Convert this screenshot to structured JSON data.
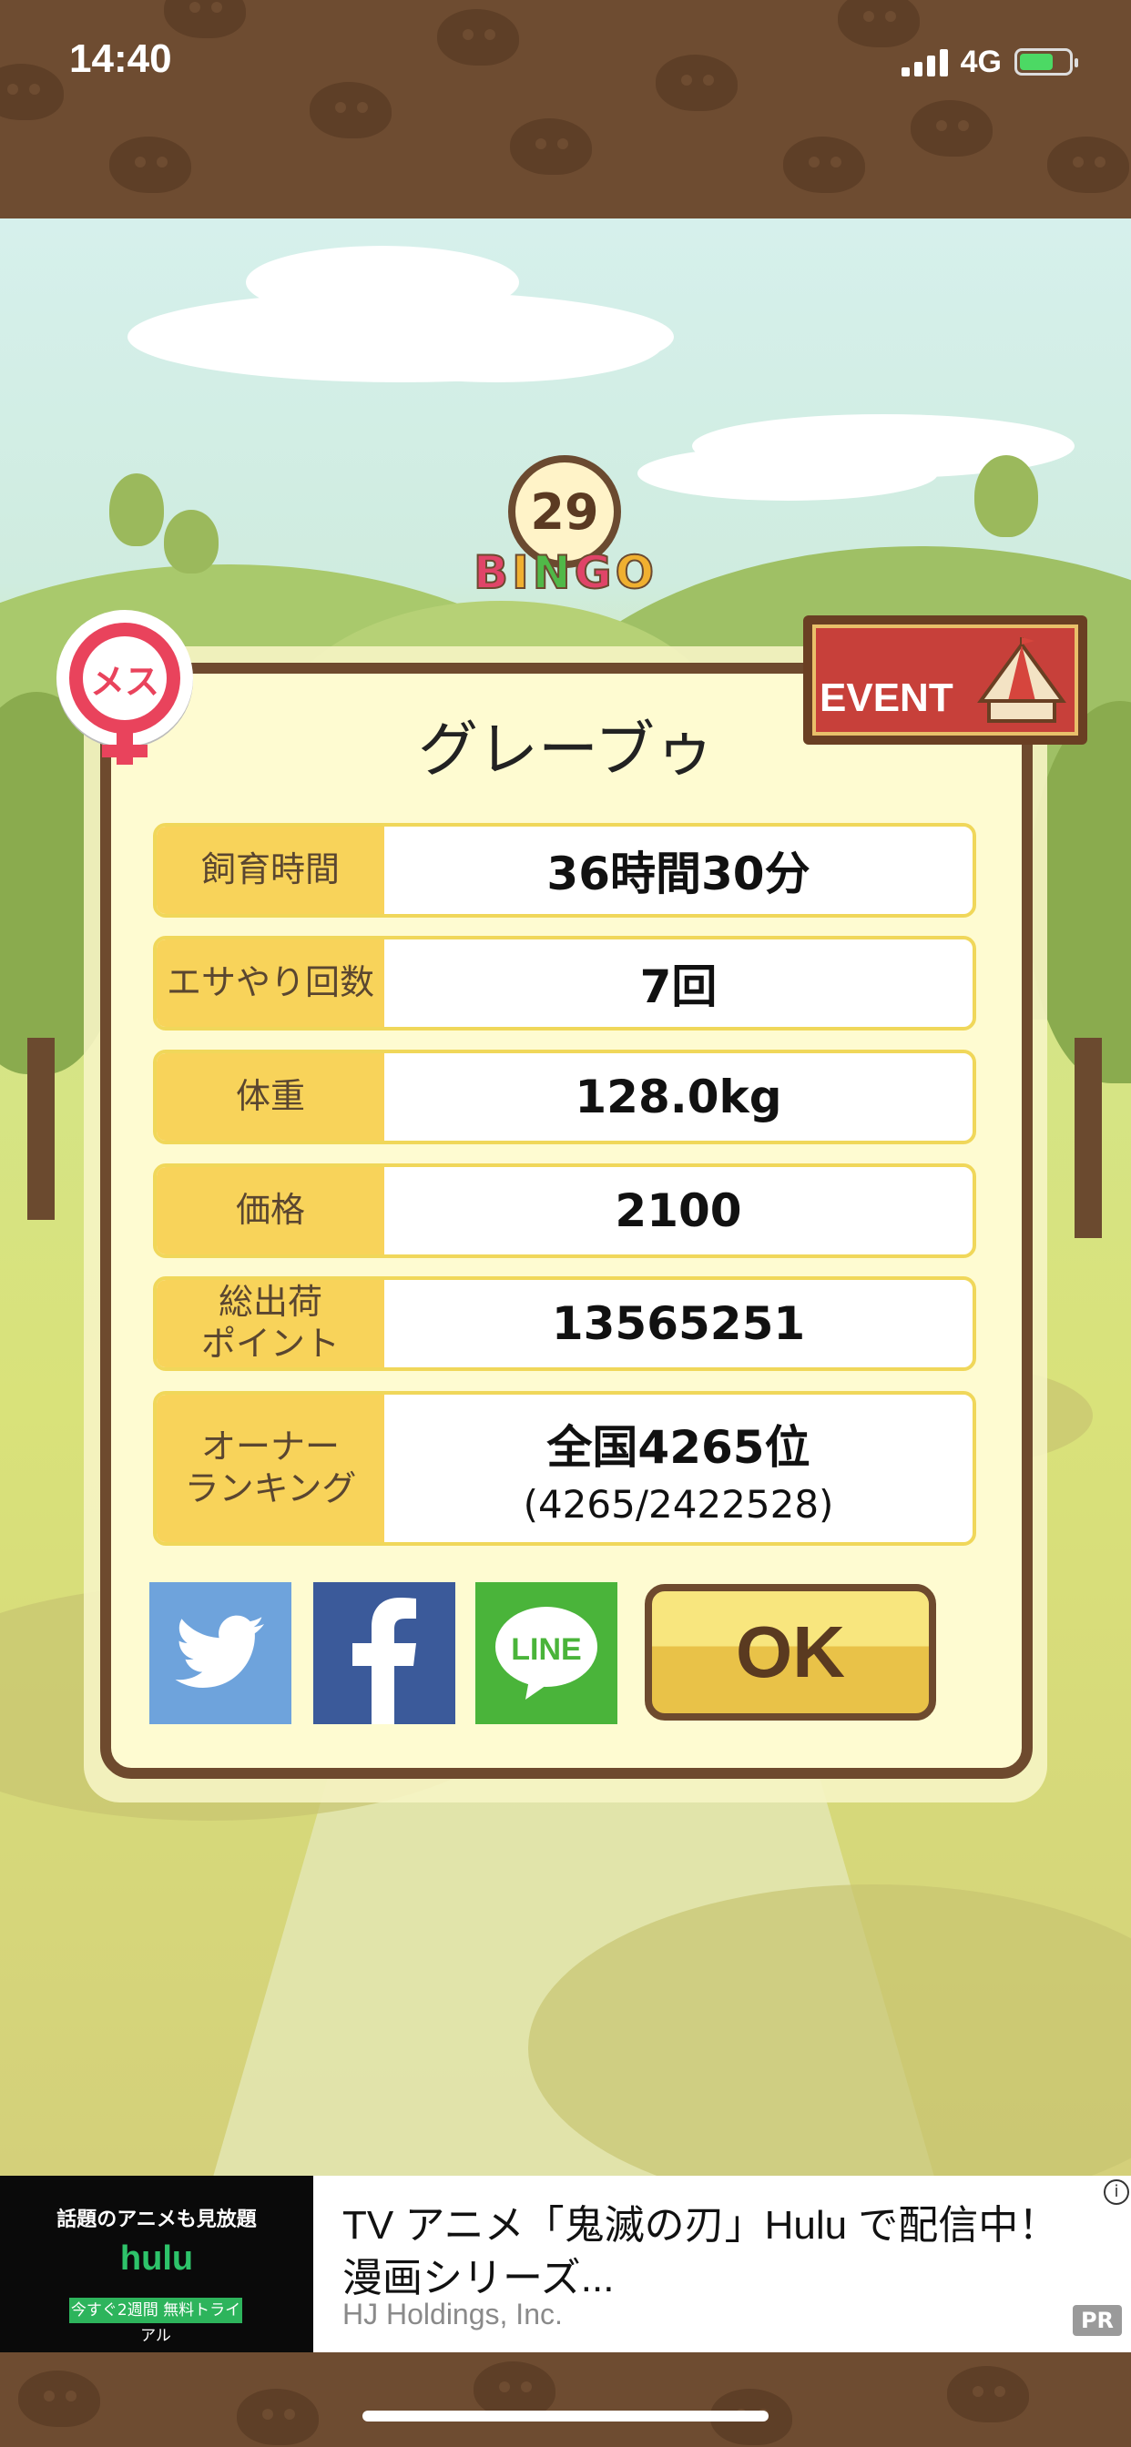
{
  "status_bar": {
    "time": "14:40",
    "network": "4G"
  },
  "bingo": {
    "number": "29",
    "word": "BINGO"
  },
  "badges": {
    "gender": "メス",
    "event": "EVENT"
  },
  "dialog": {
    "title": "グレーブゥ",
    "rows": [
      {
        "label": "飼育時間",
        "value": "36時間30分"
      },
      {
        "label": "エサやり回数",
        "value": "7回"
      },
      {
        "label": "体重",
        "value": "128.0kg"
      },
      {
        "label": "価格",
        "value": "2100"
      },
      {
        "label": "総出荷\nポイント",
        "value": "13565251"
      },
      {
        "label": "オーナー\nランキング",
        "value": "全国4265位",
        "sub": "(4265/2422528)"
      }
    ],
    "share_buttons": [
      {
        "name": "twitter",
        "icon": "twitter-bird-icon",
        "color": "#6ea3dc"
      },
      {
        "name": "facebook",
        "icon": "facebook-f-icon",
        "color": "#3b5a9a"
      },
      {
        "name": "line",
        "icon": "line-logo-icon",
        "color": "#4ab43a",
        "text": "LINE"
      }
    ],
    "ok_label": "OK"
  },
  "ad": {
    "image_tagline": "話題のアニメも見放題",
    "image_logo": "hulu",
    "image_trial": "今すぐ2週間 無料トライアル",
    "title": "TV アニメ「鬼滅の刃」Hulu で配信中！漫画シリーズ...",
    "advertiser": "HJ Holdings, Inc.",
    "pr_label": "PR",
    "info_icon": "i"
  },
  "colors": {
    "panel_border": "#6e4a2e",
    "label_bg": "#f8d35a",
    "ok_yellow": "#f8e67e"
  }
}
